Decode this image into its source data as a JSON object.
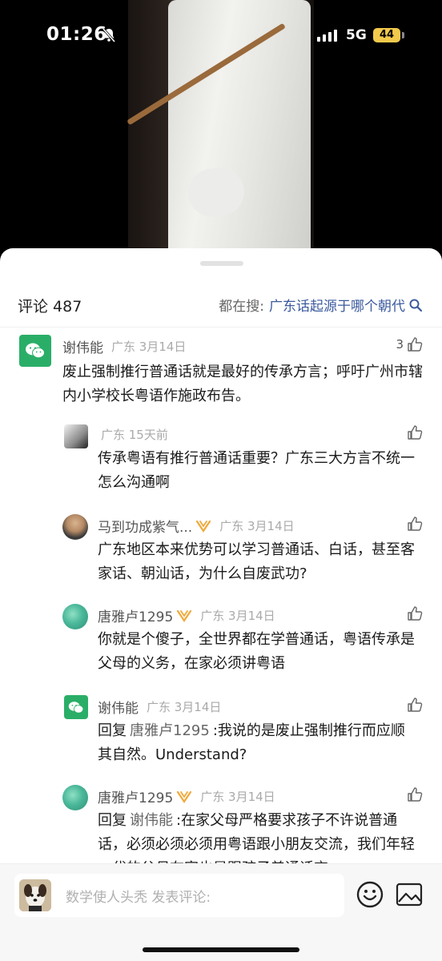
{
  "status_bar": {
    "time": "01:26",
    "network": "5G",
    "battery": "44"
  },
  "comments_header": {
    "count_label": "评论 487",
    "search_prefix": "都在搜:",
    "search_keyword": "广东话起源于哪个朝代"
  },
  "comments": [
    {
      "user": "谢伟能",
      "meta": "广东 3月14日",
      "likes": "3",
      "text": "废止强制推行普通话就是最好的传承方言；呼吁广州市辖内小学校长粤语作施政布告。"
    },
    {
      "user": "",
      "meta": "广东 15天前",
      "likes": "",
      "text": "传承粤语有推行普通话重要？广东三大方言不统一怎么沟通啊"
    },
    {
      "user": "马到功成紫气...",
      "meta": "广东 3月14日",
      "likes": "",
      "text": "广东地区本来优势可以学习普通话、白话，甚至客家话、朝汕话，为什么自废武功?"
    },
    {
      "user": "唐雅卢1295",
      "meta": "广东 3月14日",
      "likes": "",
      "text": "你就是个傻子，全世界都在学普通话，粤语传承是父母的义务，在家必须讲粤语"
    },
    {
      "user": "谢伟能",
      "meta": "广东 3月14日",
      "likes": "",
      "reply_prefix": "回复",
      "reply_to": "唐雅卢1295",
      "text": ":我说的是废止强制推行而应顺其自然。Understand?"
    },
    {
      "user": "唐雅卢1295",
      "meta": "广东 3月14日",
      "likes": "",
      "reply_prefix": "回复",
      "reply_to": "谢伟能",
      "text": ":在家父母严格要求孩子不许说普通话，必须必须必须用粤语跟小朋友交流，我们年轻一代的父母在家也是跟孩子普通话交"
    }
  ],
  "composer": {
    "placeholder": "数学使人头秃 发表评论:"
  }
}
